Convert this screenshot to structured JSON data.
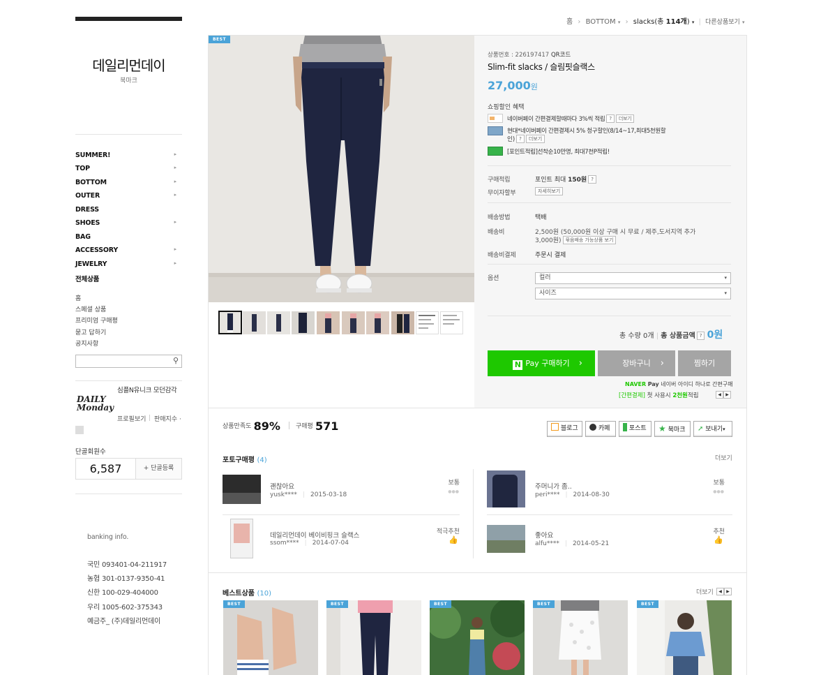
{
  "sidebar": {
    "logo": "데일리먼데이",
    "bookmark": "북마크",
    "categories": [
      "SUMMER!",
      "TOP",
      "BOTTOM",
      "OUTER",
      "DRESS",
      "SHOES",
      "BAG",
      "ACCESSORY",
      "JEWELRY",
      "전체상품"
    ],
    "links": [
      "홈",
      "스페셜 상품",
      "프리미엄 구매평",
      "묻고 답하기",
      "공지사항"
    ],
    "profile_text": "심플N유니크 모던감각",
    "daily_logo": [
      "DAILY",
      "Monday"
    ],
    "profile_link": "프로필보기",
    "fan_index": "판매지수 ·",
    "fan_label": "단골회원수",
    "fan_count": "6,587",
    "fan_register": "+ 단골등록",
    "banking_title": "banking info.",
    "banking_lines": [
      "국민 093401-04-211917",
      "농협 301-0137-9350-41",
      "신한 100-029-404000",
      "우리 1005-602-375343",
      "예금주_ (주)데일리먼데이"
    ]
  },
  "breadcrumb": {
    "home": "홈",
    "category": "BOTTOM",
    "sub_name": "slacks",
    "sub_count_prefix": "(총 ",
    "sub_count": "114개",
    "sub_count_suffix": ")",
    "other": "다른상품보기"
  },
  "product": {
    "badge": "BEST",
    "number": "상품번호 : 226197417",
    "qr": "QR코드",
    "name": "Slim-fit slacks / 슬림핏슬랙스",
    "price": "27,000",
    "price_unit": "원",
    "discount_title": "쇼핑할인 혜택",
    "benefits": [
      {
        "text": "네이버페이 간편결제할때마다 3%씩 적립",
        "btn1": "?",
        "btn2": "더보기"
      },
      {
        "text": "현대*네이버페이 간편결제시 5% 청구할인(8/14~17,최대5천원할",
        "text2": "인)",
        "btn1": "?",
        "btn2": "더보기"
      },
      {
        "text": "[포인트적립]선착순10만명, 최대7천P적립!"
      }
    ],
    "purchase_point_label": "구매적립",
    "purchase_point_value": "포인트 최대 ",
    "purchase_point_amount": "150원",
    "installment_label": "무이자할부",
    "installment_btn": "자세히보기",
    "shipping_label": "배송방법",
    "shipping_value": "택배",
    "shipping_fee_label": "배송비",
    "shipping_fee_value": "2,500원  (50,000원 이상 구매 시 무료 / 제주,도서지역 추가",
    "shipping_fee_value2": "3,000원)",
    "shipping_fee_btn": "묶음배송 가능상품 보기",
    "shipping_pay_label": "배송비결제",
    "shipping_pay_value": "주문시 결제",
    "option_label": "옵션",
    "option_color": "컬러",
    "option_size": "사이즈",
    "total_qty": "총 수량 0개",
    "total_label": "총 상품금액",
    "total_value": "0원",
    "npay_label": "Pay 구매하기",
    "cart_label": "장바구니",
    "wish_label": "찜하기",
    "naver_brand": "NAVER",
    "naver_pay": "Pay",
    "naver_note": "네이버 아이디 하나로 간편구매",
    "easy_pay_tag": "[간편결제]",
    "easy_pay_note": " 첫 사용시 ",
    "easy_pay_amount": "2천원",
    "easy_pay_suffix": "적립"
  },
  "stats": {
    "satisfaction_label": "상품만족도",
    "satisfaction_value": "89%",
    "review_label": "구매평",
    "review_value": "571",
    "share_buttons": [
      "블로그",
      "카페",
      "포스트",
      "북마크",
      "보내기"
    ]
  },
  "photo_reviews": {
    "title": "포토구매평",
    "count": "(4)",
    "more": "더보기",
    "items": [
      {
        "title": "괜찮아요",
        "user": "yusk****",
        "date": "2015-03-18",
        "rating": "보통"
      },
      {
        "title": "주머니가 좀..",
        "user": "peri****",
        "date": "2014-08-30",
        "rating": "보통"
      },
      {
        "title": "데일리먼데이 베이비핑크 슬랙스",
        "user": "ssom****",
        "date": "2014-07-04",
        "rating": "적극추천"
      },
      {
        "title": "좋아요",
        "user": "alfu****",
        "date": "2014-05-21",
        "rating": "추천"
      }
    ]
  },
  "best_products": {
    "title": "베스트상품",
    "count": "(10)",
    "more": "더보기",
    "badge": "BEST"
  },
  "colors": {
    "accent": "#4aa3d8",
    "npay_green": "#1ec800",
    "gray_button": "#a5a5a5"
  }
}
